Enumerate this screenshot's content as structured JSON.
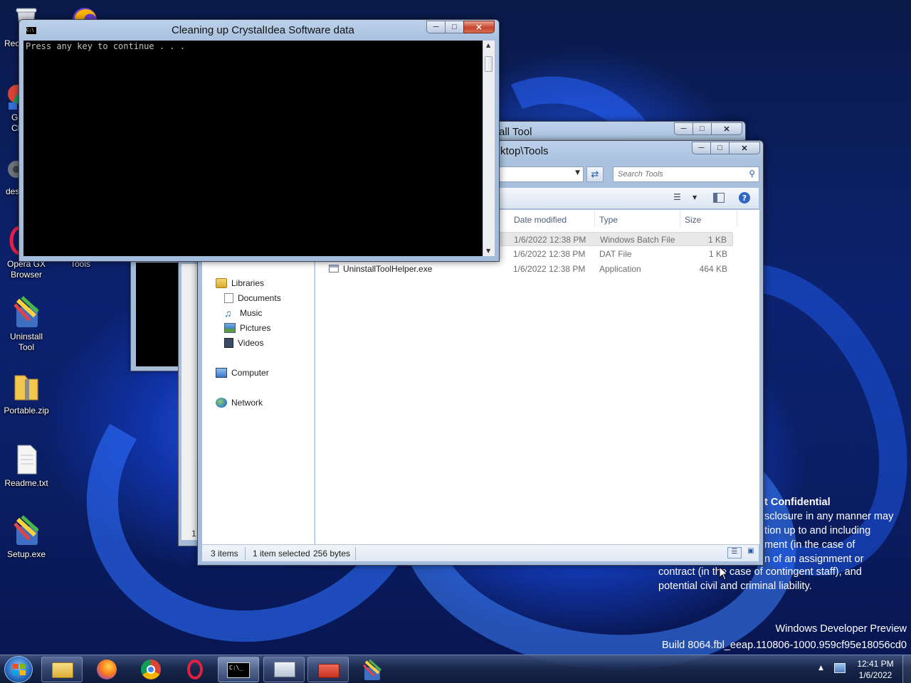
{
  "desktop": {
    "icons": [
      {
        "label": "Rec",
        "icon": "recycle-bin-icon"
      },
      {
        "label": "G\nCl",
        "icon": "google-chrome-icon"
      },
      {
        "label": "des",
        "icon": "settings-icon"
      },
      {
        "label": "Opera GX\nBrowser",
        "icon": "opera-gx-icon"
      },
      {
        "label": "Tools",
        "icon": "folder-icon"
      },
      {
        "label": "Uninstall\nTool",
        "icon": "uninstall-tool-icon"
      },
      {
        "label": "Portable.zip",
        "icon": "zip-folder-icon"
      },
      {
        "label": "Readme.txt",
        "icon": "text-file-icon"
      },
      {
        "label": "Setup.exe",
        "icon": "installer-icon"
      }
    ],
    "watermark": {
      "title": "t Confidential",
      "lines": [
        "sclosure in any manner may",
        "tion up to and including",
        "ment (in the case of",
        "n of an assignment or",
        "contract (in the case of contingent staff), and",
        "potential civil and criminal liability."
      ],
      "edition": "Windows Developer Preview",
      "build": "Build 8064.fbl_eeap.110806-1000.959cf95e18056cd0"
    }
  },
  "cmd_window": {
    "title": "Cleaning up CrystalIdea Software data",
    "output": "Press any key to continue . . ."
  },
  "uninstall_window": {
    "title": "all Tool"
  },
  "explorer": {
    "title": "ktop\\Tools",
    "search_placeholder": "Search Tools",
    "columns": [
      "Date modified",
      "Type",
      "Size"
    ],
    "files": [
      {
        "name": "",
        "date": "1/6/2022 12:38 PM",
        "type": "Windows Batch File",
        "size": "1 KB",
        "selected": true
      },
      {
        "name": "",
        "date": "1/6/2022 12:38 PM",
        "type": "DAT File",
        "size": "1 KB",
        "selected": false
      },
      {
        "name": "UninstallToolHelper.exe",
        "date": "1/6/2022 12:38 PM",
        "type": "Application",
        "size": "464 KB",
        "selected": false
      }
    ],
    "nav": {
      "libraries": "Libraries",
      "documents": "Documents",
      "music": "Music",
      "pictures": "Pictures",
      "videos": "Videos",
      "computer": "Computer",
      "network": "Network"
    },
    "status": {
      "items": "3 items",
      "selected": "1 item selected",
      "bytes": "256 bytes"
    }
  },
  "background_window": {
    "status_char": "1"
  },
  "taskbar": {
    "buttons": [
      {
        "name": "start-button",
        "icon": "windows-logo-icon"
      },
      {
        "name": "explorer-button",
        "icon": "folder-icon"
      },
      {
        "name": "firefox-button",
        "icon": "firefox-icon"
      },
      {
        "name": "chrome-button",
        "icon": "chrome-icon"
      },
      {
        "name": "opera-button",
        "icon": "opera-icon"
      },
      {
        "name": "cmd-button",
        "icon": "command-prompt-icon"
      },
      {
        "name": "perfmon-button",
        "icon": "monitor-icon"
      },
      {
        "name": "toolbox-button",
        "icon": "toolbox-icon"
      },
      {
        "name": "uninstall-tool-button",
        "icon": "uninstall-tool-icon"
      }
    ],
    "clock_time": "12:41 PM",
    "clock_date": "1/6/2022"
  },
  "colors": {
    "accent": "#1a4bd6",
    "console_bg": "#000000",
    "console_fg": "#c0c0c0",
    "close_button": "#c7442e"
  }
}
